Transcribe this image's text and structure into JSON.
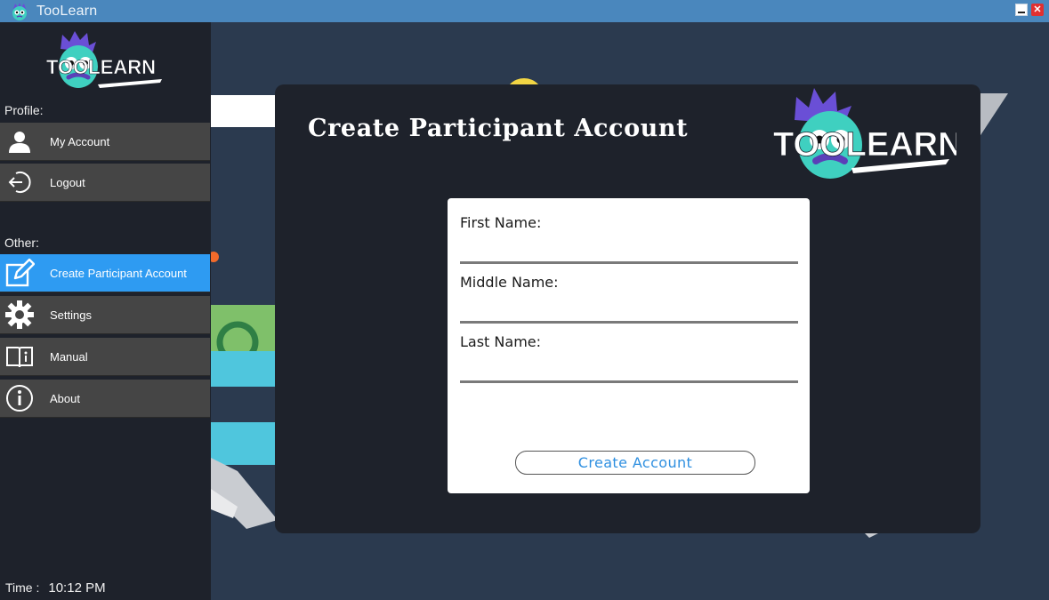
{
  "window": {
    "title": "TooLearn",
    "close_glyph": "✕"
  },
  "branding": {
    "logo_text": "TOOLEARN",
    "logo_icon": "mascot-logo",
    "brand_purple": "#6a4fd6",
    "brand_teal": "#3fd0c0"
  },
  "sidebar": {
    "profile_label": "Profile:",
    "other_label": "Other:",
    "profile_items": [
      {
        "label": "My Account",
        "icon": "user-icon"
      },
      {
        "label": "Logout",
        "icon": "logout-icon"
      }
    ],
    "other_items": [
      {
        "label": "Create Participant Account",
        "icon": "edit-icon",
        "active": true
      },
      {
        "label": "Settings",
        "icon": "gear-icon"
      },
      {
        "label": "Manual",
        "icon": "book-icon"
      },
      {
        "label": "About",
        "icon": "info-icon"
      }
    ],
    "time_label": "Time :",
    "time_value": "10:12 PM"
  },
  "main": {
    "title": "Create Participant Account",
    "form": {
      "first_name_label": "First Name:",
      "first_name_value": "",
      "middle_name_label": "Middle Name:",
      "middle_name_value": "",
      "last_name_label": "Last Name:",
      "last_name_value": "",
      "submit_label": "Create Account"
    }
  },
  "colors": {
    "titlebar": "#4a87bd",
    "sidebar": "#1e222b",
    "nav_item": "#454545",
    "nav_active": "#2e9bf2",
    "accent_link": "#2e8fe0",
    "background": "#2b3a4f"
  }
}
